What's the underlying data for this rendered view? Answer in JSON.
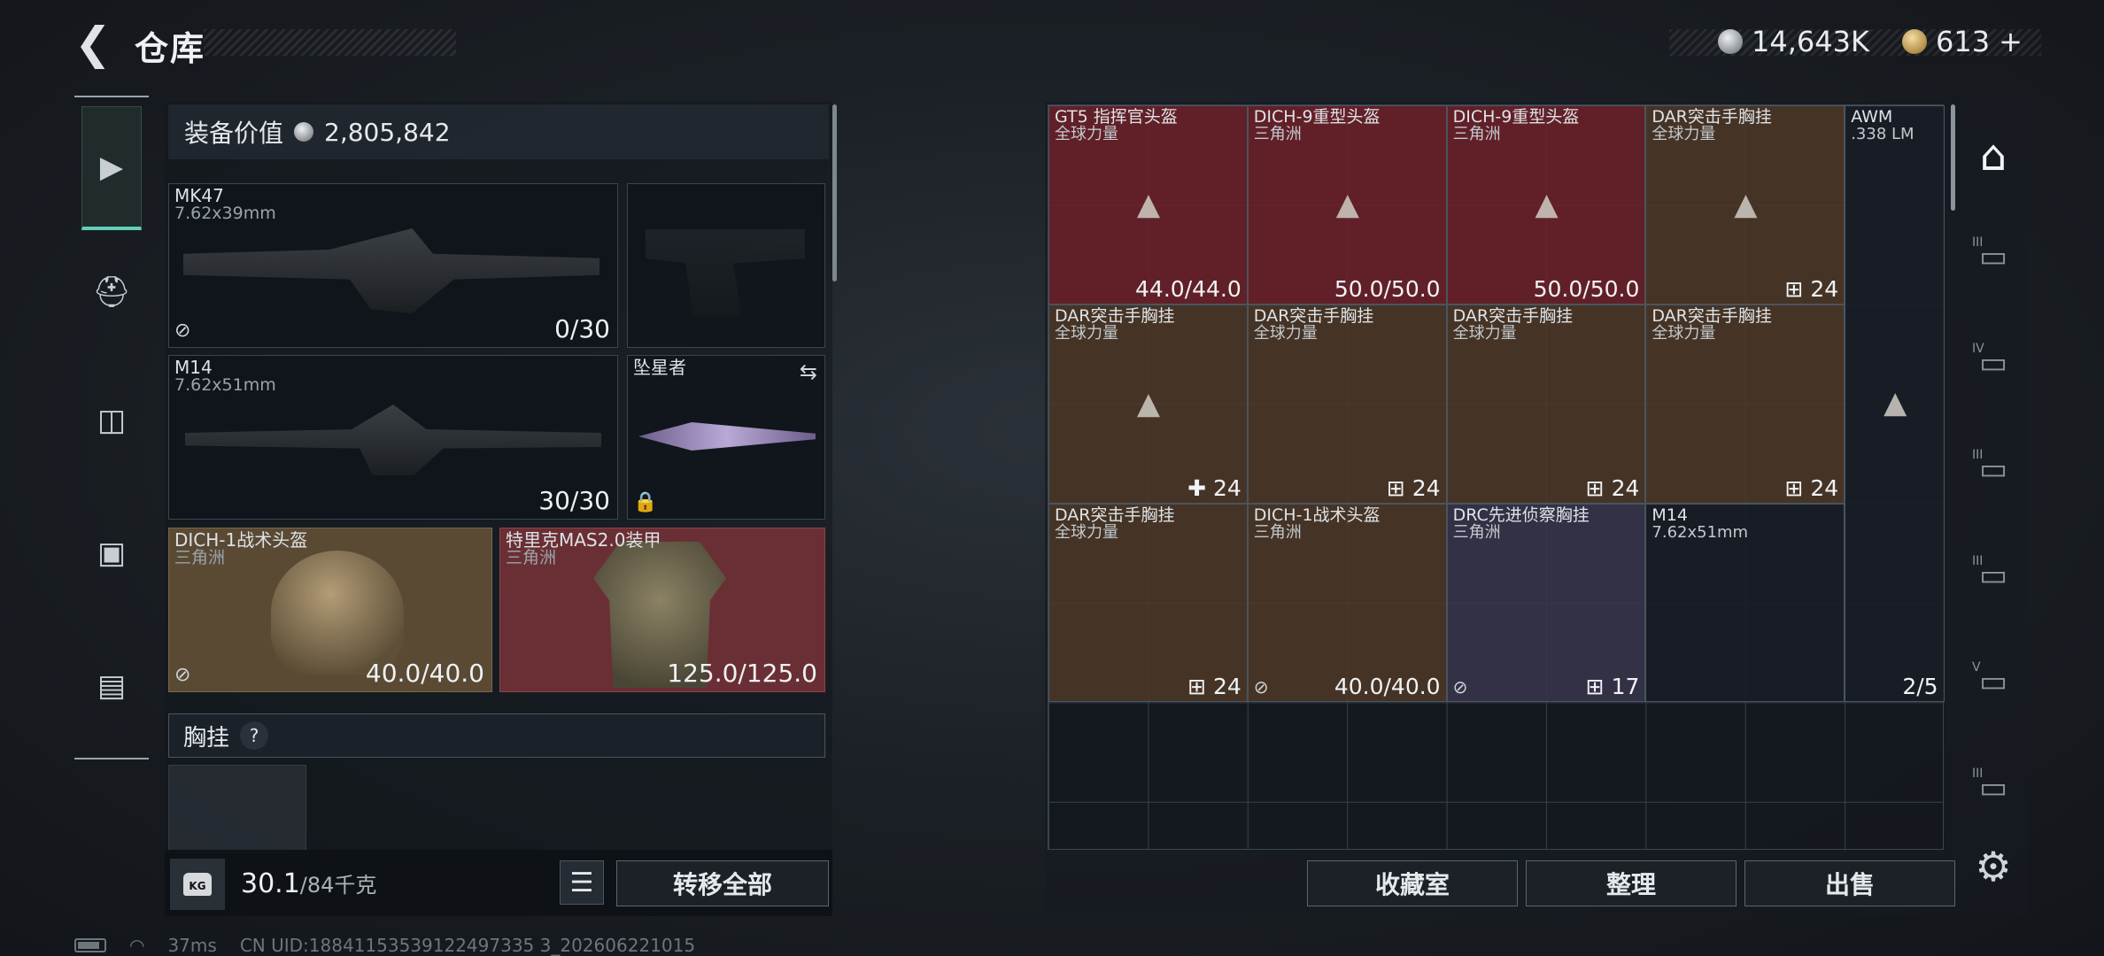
{
  "header": {
    "back_icon": "back-arrow-icon",
    "title": "仓库",
    "currencies": [
      {
        "icon": "silver-coin-icon",
        "value": "14,643K"
      },
      {
        "icon": "gold-coin-icon",
        "value": "613",
        "plus": "+"
      }
    ]
  },
  "equipment": {
    "label": "装备价值",
    "value": "2,805,842",
    "slots": [
      {
        "name": "MK47",
        "sub": "7.62x39mm",
        "value": "0/30"
      },
      {
        "name": "M14",
        "sub": "7.62x51mm",
        "value": "30/30"
      },
      {
        "name": "坠星者",
        "swap_icon": "⇆"
      },
      {
        "name": "DICH-1战术头盔",
        "sub": "三角洲",
        "value": "40.0/40.0"
      },
      {
        "name": "特里克MAS2.0装甲",
        "sub": "三角洲",
        "value": "125.0/125.0"
      }
    ],
    "vest_label": "胸挂",
    "vest_help": "?"
  },
  "footer_left": {
    "weight": "30.1",
    "weight_max": "/84千克",
    "kg_label": "KG",
    "list_icon": "☰",
    "transfer_label": "转移全部"
  },
  "grid": {
    "items": [
      {
        "name": "GT5 指挥官头盔",
        "sub": "全球力量",
        "value": "44.0/44.0"
      },
      {
        "name": "DICH-9重型头盔",
        "sub": "三角洲",
        "value": "50.0/50.0"
      },
      {
        "name": "DICH-9重型头盔",
        "sub": "三角洲",
        "value": "50.0/50.0"
      },
      {
        "name": "DAR突击手胸挂",
        "sub": "全球力量",
        "value": "24"
      },
      {
        "name": "AWM",
        "sub": ".338 LM",
        "value": "2/5"
      },
      {
        "name": "DAR突击手胸挂",
        "sub": "全球力量",
        "value": "24"
      },
      {
        "name": "DAR突击手胸挂",
        "sub": "全球力量",
        "value": "24"
      },
      {
        "name": "DAR突击手胸挂",
        "sub": "全球力量",
        "value": "24"
      },
      {
        "name": "DAR突击手胸挂",
        "sub": "全球力量",
        "value": "24"
      },
      {
        "name": "DAR突击手胸挂",
        "sub": "全球力量",
        "value": "24"
      },
      {
        "name": "DICH-1战术头盔",
        "sub": "三角洲",
        "value": "40.0/40.0"
      },
      {
        "name": "DRC先进侦察胸挂",
        "sub": "三角洲",
        "value": "17"
      },
      {
        "name": "M14",
        "sub": "7.62x51mm"
      }
    ]
  },
  "buttons": {
    "collection": "收藏室",
    "organize": "整理",
    "sell": "出售"
  },
  "right_nav": {
    "levels": [
      "III",
      "IV",
      "III",
      "III",
      "V",
      "III"
    ]
  },
  "status": {
    "ping": "37ms",
    "uid": "CN UID:18841153539122497335 3_202606221015"
  }
}
